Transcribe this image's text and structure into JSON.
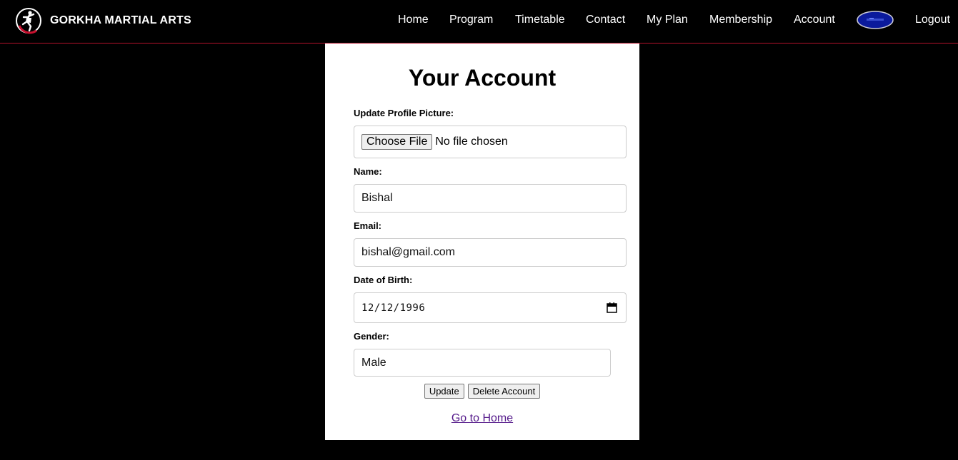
{
  "brand": {
    "name": "GORKHA MARTIAL ARTS",
    "logo_icon": "karate-kick-icon"
  },
  "nav": {
    "items": [
      {
        "label": "Home"
      },
      {
        "label": "Program"
      },
      {
        "label": "Timetable"
      },
      {
        "label": "Contact"
      },
      {
        "label": "My Plan"
      },
      {
        "label": "Membership"
      },
      {
        "label": "Account"
      },
      {
        "label": "Logout"
      }
    ],
    "avatar_icon": "profile-avatar-icon"
  },
  "account": {
    "title": "Your Account",
    "profile_picture": {
      "label": "Update Profile Picture:",
      "button": "Choose File",
      "status": "No file chosen"
    },
    "name": {
      "label": "Name:",
      "value": "Bishal"
    },
    "email": {
      "label": "Email:",
      "value": "bishal@gmail.com"
    },
    "dob": {
      "label": "Date of Birth:",
      "value": "12/12/1996",
      "icon": "calendar-icon"
    },
    "gender": {
      "label": "Gender:",
      "value": "Male"
    },
    "update_button": "Update",
    "delete_button": "Delete Account",
    "home_link": "Go to Home"
  },
  "colors": {
    "background": "#000000",
    "card": "#ffffff",
    "nav_border": "#b5122b",
    "link_visited": "#551a8b"
  }
}
